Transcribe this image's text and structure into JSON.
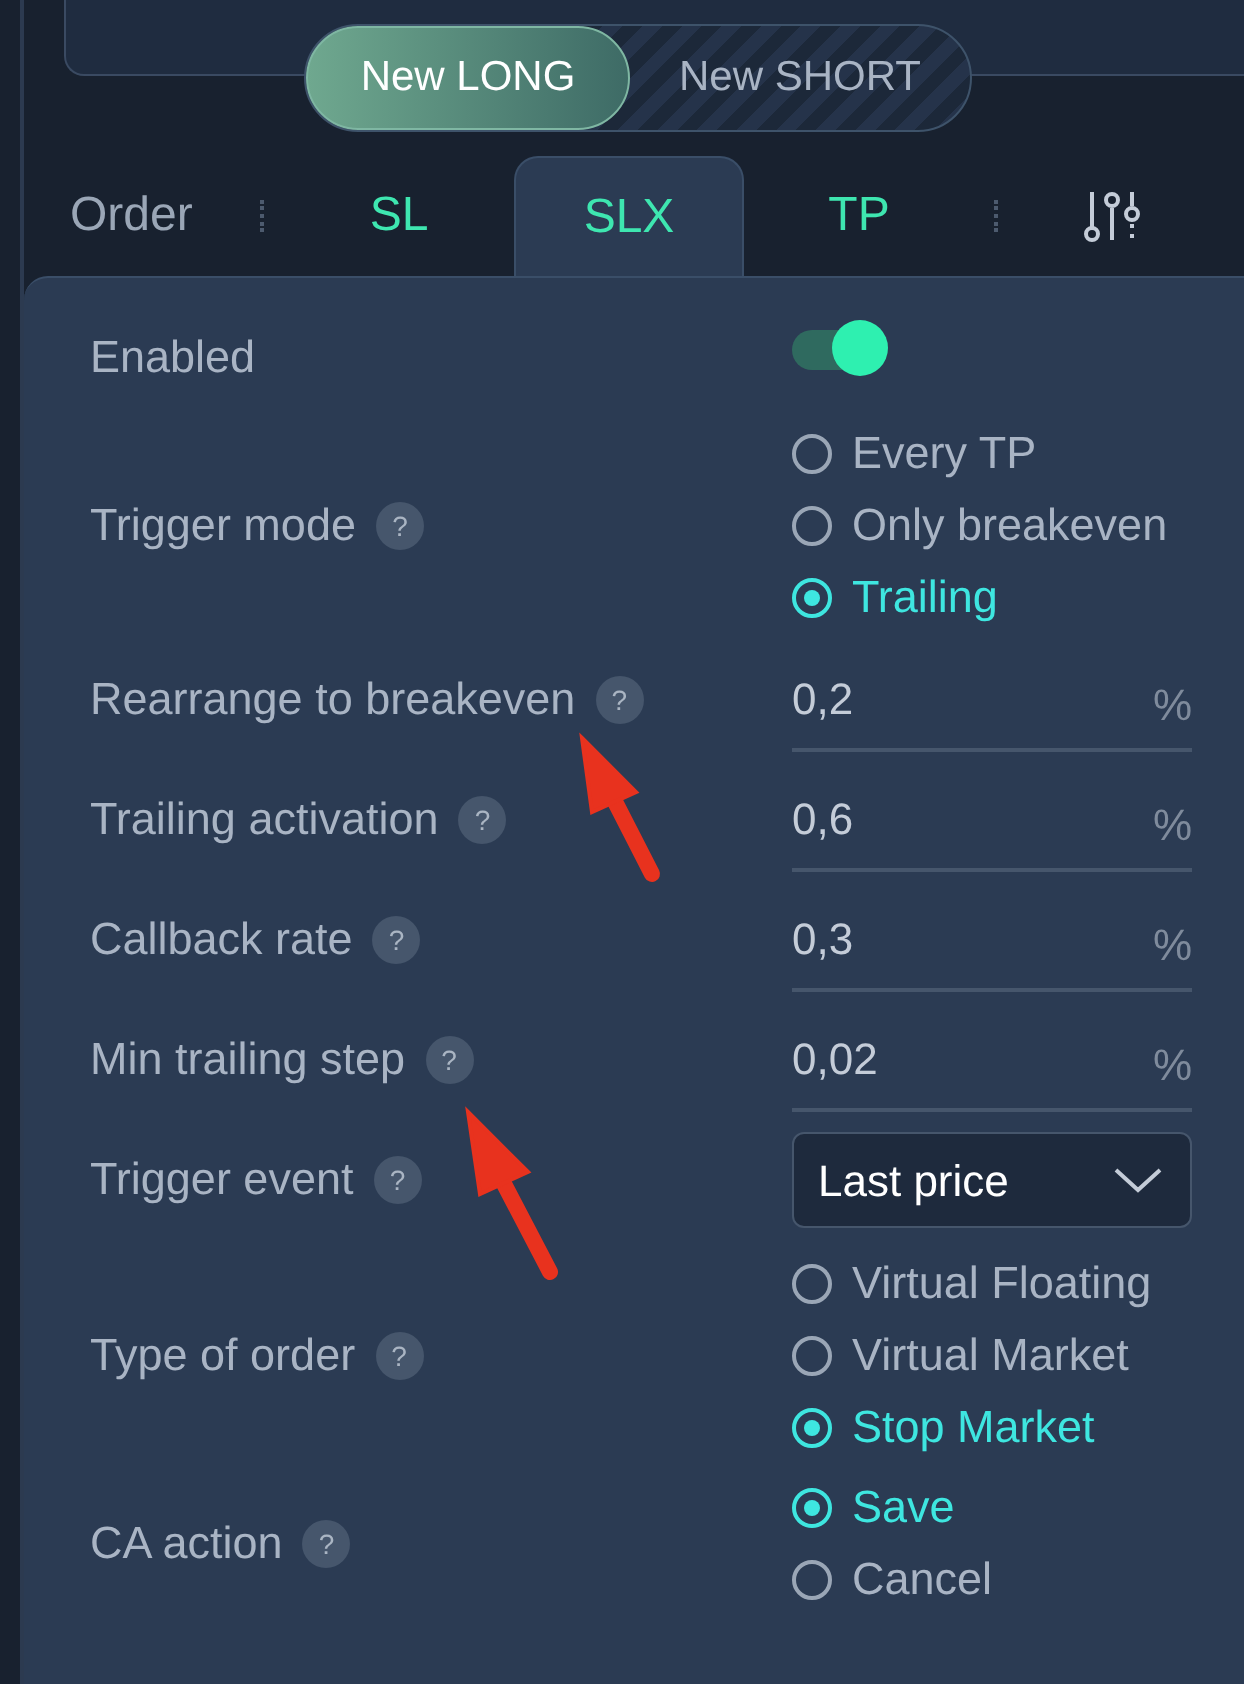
{
  "order_side": [
    {
      "label": "New LONG",
      "selected": true
    },
    {
      "label": "New SHORT",
      "selected": false
    }
  ],
  "order_label": "Order",
  "tabs": [
    {
      "label": "SL",
      "selected": false
    },
    {
      "label": "SLX",
      "selected": true
    },
    {
      "label": "TP",
      "selected": false
    }
  ],
  "settings": [
    {
      "kind": "switch",
      "label": "Enabled",
      "on": true
    },
    {
      "kind": "radio",
      "label": "Trigger mode",
      "help": "?",
      "options": [
        {
          "label": "Every TP",
          "selected": false
        },
        {
          "label": "Only breakeven",
          "selected": false
        },
        {
          "label": "Trailing",
          "selected": true
        }
      ]
    },
    {
      "kind": "number",
      "label": "Rearrange to breakeven",
      "help": "?",
      "value": "0,2",
      "unit": "%"
    },
    {
      "kind": "number",
      "label": "Trailing activation",
      "help": "?",
      "value": "0,6",
      "unit": "%"
    },
    {
      "kind": "number",
      "label": "Callback rate",
      "help": "?",
      "value": "0,3",
      "unit": "%"
    },
    {
      "kind": "number",
      "label": "Min trailing step",
      "help": "?",
      "value": "0,02",
      "unit": "%"
    },
    {
      "kind": "select",
      "label": "Trigger event",
      "help": "?",
      "value": "Last price"
    },
    {
      "kind": "radio",
      "label": "Type of order",
      "help": "?",
      "options": [
        {
          "label": "Virtual Floating",
          "selected": false
        },
        {
          "label": "Virtual Market",
          "selected": false
        },
        {
          "label": "Stop Market",
          "selected": true
        }
      ]
    },
    {
      "kind": "radio",
      "label": "CA action",
      "help": "?",
      "options": [
        {
          "label": "Save",
          "selected": true
        },
        {
          "label": "Cancel",
          "selected": false
        }
      ]
    }
  ]
}
